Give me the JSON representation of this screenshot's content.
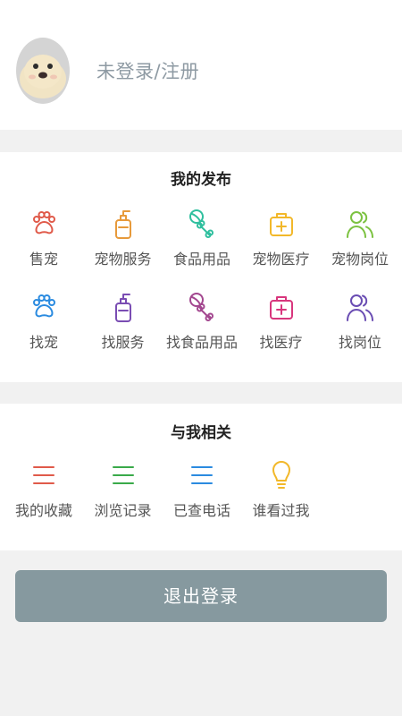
{
  "header": {
    "login_text": "未登录/注册",
    "avatar_icon": "seal-avatar-icon"
  },
  "publish": {
    "title": "我的发布",
    "items": [
      {
        "label": "售宠",
        "icon": "paw-icon",
        "color": "#e05a4a"
      },
      {
        "label": "宠物服务",
        "icon": "pump-bottle-icon",
        "color": "#e79a3b"
      },
      {
        "label": "食品用品",
        "icon": "bone-ball-icon",
        "color": "#2fbf9e"
      },
      {
        "label": "宠物医疗",
        "icon": "medical-kit-icon",
        "color": "#f2b82a"
      },
      {
        "label": "宠物岗位",
        "icon": "people-icon",
        "color": "#7cc241"
      },
      {
        "label": "找宠",
        "icon": "paw-icon",
        "color": "#2b8be0"
      },
      {
        "label": "找服务",
        "icon": "pump-bottle-icon",
        "color": "#7a4db3"
      },
      {
        "label": "找食品用品",
        "icon": "bone-ball-icon",
        "color": "#a3478f"
      },
      {
        "label": "找医疗",
        "icon": "medical-kit-icon",
        "color": "#d8367d"
      },
      {
        "label": "找岗位",
        "icon": "people-icon",
        "color": "#6a4db3"
      }
    ]
  },
  "related": {
    "title": "与我相关",
    "items": [
      {
        "label": "我的收藏",
        "icon": "list-icon",
        "color": "#e05a4a"
      },
      {
        "label": "浏览记录",
        "icon": "list-icon",
        "color": "#3aaa4a"
      },
      {
        "label": "已查电话",
        "icon": "list-icon",
        "color": "#2b8be0"
      },
      {
        "label": "谁看过我",
        "icon": "lightbulb-icon",
        "color": "#f2b82a"
      }
    ]
  },
  "logout_label": "退出登录"
}
